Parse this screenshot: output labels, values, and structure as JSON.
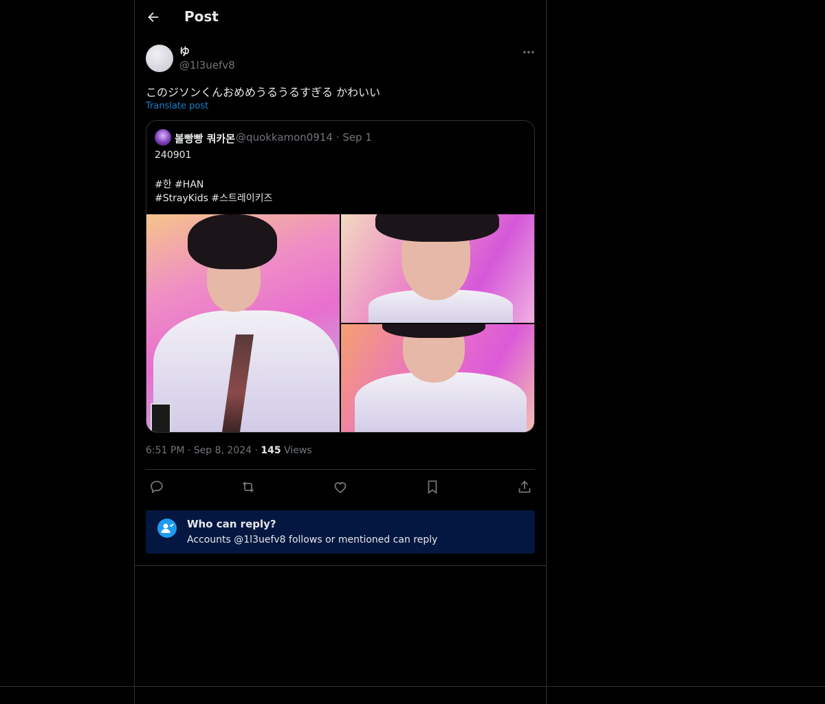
{
  "header": {
    "title": "Post",
    "back_icon": "arrow-left-icon"
  },
  "post": {
    "display_name": "ゆ",
    "handle": "@1l3uefv8",
    "text": "このジソンくんおめめうるうるすぎる かわいい",
    "translate_label": "Translate post",
    "timestamp": "6:51 PM",
    "date": "Sep 8, 2024",
    "views_count": "145",
    "views_label": "Views"
  },
  "quote": {
    "display_name": "볼빵빵 쿼카몬",
    "handle": "@quokkamon0914",
    "date": "Sep 1",
    "lines": [
      "240901",
      "",
      "#한 #HAN",
      "#StrayKids  #스트레이키즈"
    ]
  },
  "actions": [
    "reply-icon",
    "repost-icon",
    "like-icon",
    "bookmark-icon",
    "share-icon"
  ],
  "reply_notice": {
    "title": "Who can reply?",
    "subtitle": "Accounts @1l3uefv8 follows or mentioned can reply"
  },
  "colors": {
    "accent": "#1d9bf0",
    "notice_bg": "#031740",
    "border": "#2f3336",
    "muted": "#71767b"
  }
}
